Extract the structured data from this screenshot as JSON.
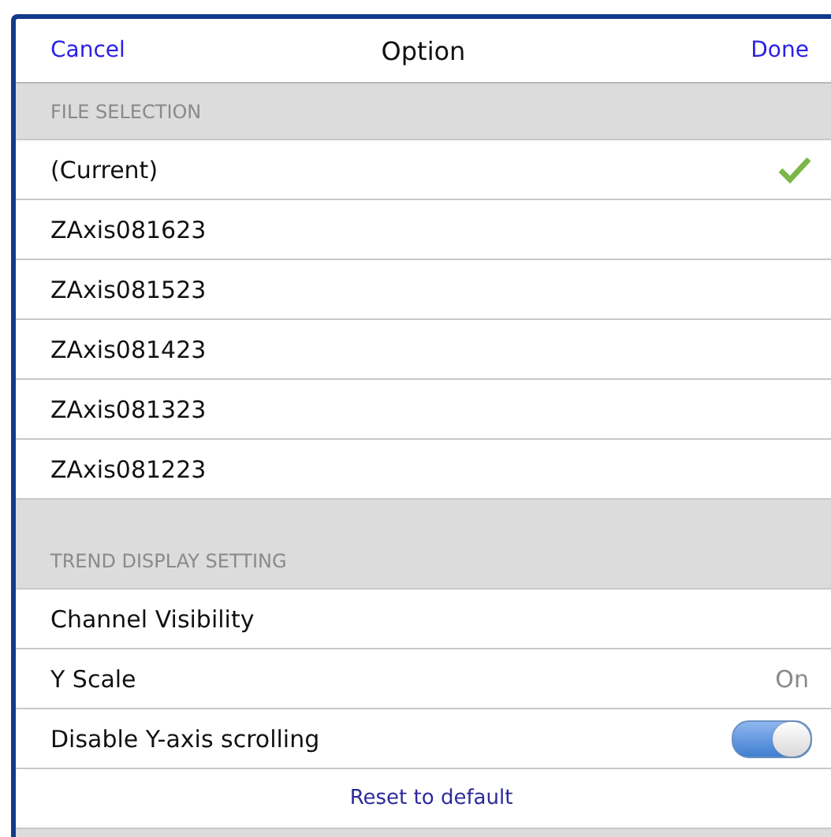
{
  "header": {
    "cancel": "Cancel",
    "title": "Option",
    "done": "Done"
  },
  "sections": [
    {
      "title": "FILE SELECTION",
      "spaced": false,
      "rows": [
        {
          "kind": "select",
          "label": "(Current)",
          "selected": true
        },
        {
          "kind": "select",
          "label": "ZAxis081623",
          "selected": false
        },
        {
          "kind": "select",
          "label": "ZAxis081523",
          "selected": false
        },
        {
          "kind": "select",
          "label": "ZAxis081423",
          "selected": false
        },
        {
          "kind": "select",
          "label": "ZAxis081323",
          "selected": false
        },
        {
          "kind": "select",
          "label": "ZAxis081223",
          "selected": false
        }
      ]
    },
    {
      "title": "TREND DISPLAY SETTING",
      "spaced": true,
      "rows": [
        {
          "kind": "nav",
          "label": "Channel Visibility"
        },
        {
          "kind": "value",
          "label": "Y Scale",
          "value": "On"
        },
        {
          "kind": "switch",
          "label": "Disable Y-axis scrolling",
          "on": true
        },
        {
          "kind": "action",
          "label": "Reset to default"
        }
      ]
    }
  ]
}
